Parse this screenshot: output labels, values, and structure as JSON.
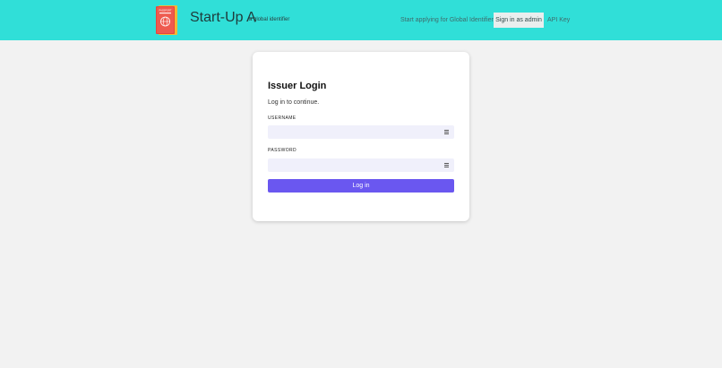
{
  "header": {
    "brand": {
      "title": "Start-Up A",
      "subtitle": "a global identifier",
      "logo_icon": "passport-icon",
      "logo_text": "PASSPORT"
    },
    "nav": {
      "apply_label": "Start applying for Global Identifier",
      "admin_label": "Sign in as admin",
      "api_label": "API Key"
    }
  },
  "login": {
    "title": "Issuer Login",
    "subtitle": "Log in to continue.",
    "username": {
      "label": "USERNAME",
      "value": "",
      "placeholder": "",
      "icon": "menu-icon"
    },
    "password": {
      "label": "PASSWORD",
      "value": "",
      "placeholder": "",
      "icon": "menu-icon"
    },
    "submit_label": "Log in"
  },
  "colors": {
    "header_bg": "#30dfd8",
    "page_bg": "#f2f2f2",
    "button_bg": "#6a57f0",
    "input_bg": "#f0f0fb"
  }
}
